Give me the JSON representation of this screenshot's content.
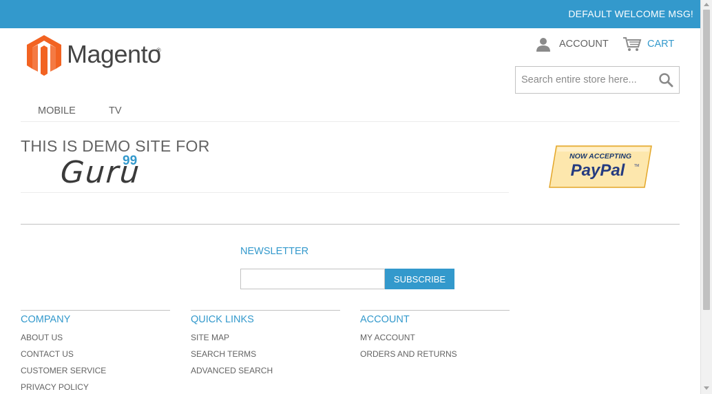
{
  "header": {
    "welcome_msg": "DEFAULT WELCOME MSG!",
    "logo_text": "Magento",
    "logo_reg": "®",
    "account_label": "ACCOUNT",
    "cart_label": "CART",
    "search_placeholder": "Search entire store here..."
  },
  "nav": {
    "items": [
      {
        "label": "MOBILE"
      },
      {
        "label": "TV"
      }
    ]
  },
  "banner": {
    "title": "THIS IS DEMO SITE FOR",
    "guru_text": "Guru",
    "guru_sup": "99",
    "paypal_top": "NOW ACCEPTING",
    "paypal_main": "PayPal",
    "paypal_tm": "TM"
  },
  "newsletter": {
    "title": "NEWSLETTER",
    "input_value": "",
    "button_label": "SUBSCRIBE"
  },
  "footer": {
    "columns": [
      {
        "title": "COMPANY",
        "links": [
          "ABOUT US",
          "CONTACT US",
          "CUSTOMER SERVICE",
          "PRIVACY POLICY"
        ]
      },
      {
        "title": "QUICK LINKS",
        "links": [
          "SITE MAP",
          "SEARCH TERMS",
          "ADVANCED SEARCH"
        ]
      },
      {
        "title": "ACCOUNT",
        "links": [
          "MY ACCOUNT",
          "ORDERS AND RETURNS"
        ]
      }
    ]
  },
  "colors": {
    "accent": "#3399cc",
    "text": "#636363",
    "logo_orange": "#f26322"
  }
}
